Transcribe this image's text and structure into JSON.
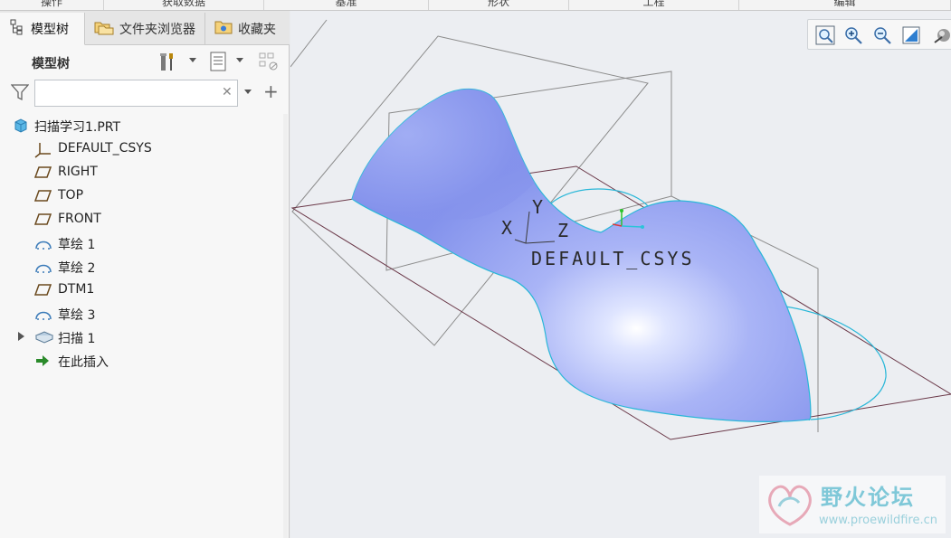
{
  "ribbon": {
    "groups": [
      "操作",
      "获取数据",
      "基准",
      "形状",
      "工程",
      "编辑"
    ]
  },
  "tabs": [
    {
      "label": "模型树",
      "active": true,
      "icon": "model-tree-icon"
    },
    {
      "label": "文件夹浏览器",
      "active": false,
      "icon": "folder-browser-icon"
    },
    {
      "label": "收藏夹",
      "active": false,
      "icon": "favorites-icon"
    }
  ],
  "toolbar": {
    "title": "模型树",
    "buttons": [
      "settings-tools-icon",
      "show-list-icon",
      "tree-filter-icon"
    ]
  },
  "filter": {
    "placeholder": "",
    "value": ""
  },
  "tree": [
    {
      "label": "扫描学习1.PRT",
      "icon": "part-icon",
      "indent": 0
    },
    {
      "label": "DEFAULT_CSYS",
      "icon": "csys-icon",
      "indent": 1
    },
    {
      "label": "RIGHT",
      "icon": "datum-plane-icon",
      "indent": 1
    },
    {
      "label": "TOP",
      "icon": "datum-plane-icon",
      "indent": 1
    },
    {
      "label": "FRONT",
      "icon": "datum-plane-icon",
      "indent": 1
    },
    {
      "label": "草绘 1",
      "icon": "sketch-icon",
      "indent": 1
    },
    {
      "label": "草绘 2",
      "icon": "sketch-icon",
      "indent": 1
    },
    {
      "label": "DTM1",
      "icon": "datum-plane-icon",
      "indent": 1
    },
    {
      "label": "草绘 3",
      "icon": "sketch-icon",
      "indent": 1
    },
    {
      "label": "扫描 1",
      "icon": "sweep-icon",
      "indent": 1,
      "expandable": true
    },
    {
      "label": "在此插入",
      "icon": "insert-here-icon",
      "indent": 1
    }
  ],
  "viewport": {
    "csys_label": "DEFAULT_CSYS",
    "axis_x": "X",
    "axis_y": "Y",
    "axis_z": "Z",
    "view_tools": [
      "zoom-fit-icon",
      "zoom-in-icon",
      "zoom-out-icon",
      "repaint-icon",
      "display-style-icon"
    ]
  },
  "watermark": {
    "title": "野火论坛",
    "url": "www.proewildfire.cn"
  },
  "colors": {
    "surface": "#8f9ff0",
    "edge": "#29b7d8",
    "datum_plane": "#7a6a6a",
    "accent_cyan": "#2bc4d9"
  }
}
